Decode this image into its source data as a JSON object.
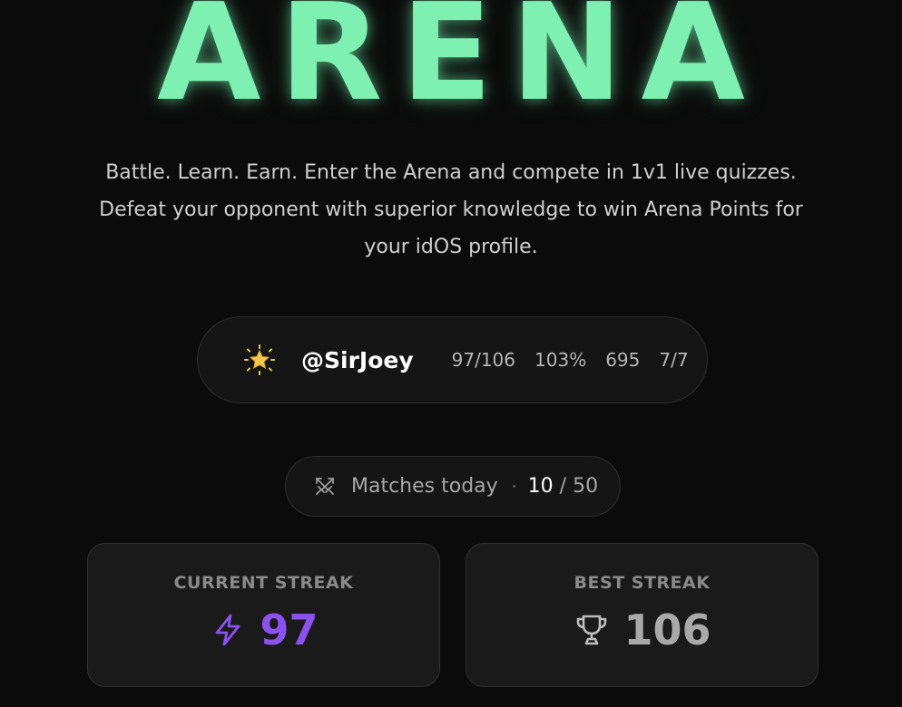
{
  "hero": {
    "title": "ARENA",
    "subtitle": "Battle. Learn. Earn. Enter the Arena and compete in 1v1 live quizzes. Defeat your opponent with superior knowledge to win Arena Points for your idOS profile."
  },
  "profile": {
    "badge_icon": "star-badge-icon",
    "username": "@SirJoey",
    "stats": [
      "97/106",
      "103%",
      "695",
      "7/7"
    ]
  },
  "matches": {
    "icon": "crossed-swords-icon",
    "label": "Matches today",
    "count": "10",
    "separator": "/",
    "limit": "50"
  },
  "streaks": {
    "current": {
      "label": "CURRENT STREAK",
      "icon": "lightning-bolt-icon",
      "value": "97"
    },
    "best": {
      "label": "BEST STREAK",
      "icon": "trophy-icon",
      "value": "106"
    }
  },
  "colors": {
    "background": "#0b0b0b",
    "title_glow": "#7ef0b2",
    "current_streak": "#8c52f0",
    "best_streak": "#a9a9a9",
    "badge_gold": "#f5c84a"
  }
}
